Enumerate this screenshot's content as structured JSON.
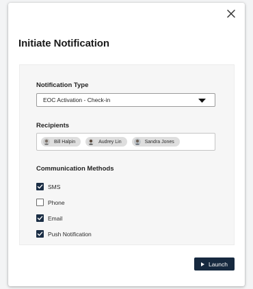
{
  "dialog": {
    "title": "Initiate Notification",
    "close_icon": "close-icon"
  },
  "notification_type": {
    "label": "Notification Type",
    "selected": "EOC Activation - Check-in",
    "icon": "caret-down-icon"
  },
  "recipients": {
    "label": "Recipients",
    "people": [
      {
        "name": "Bill Halpin",
        "icon": "avatar"
      },
      {
        "name": "Audrey Lin",
        "icon": "avatar"
      },
      {
        "name": "Sandra Jones",
        "icon": "avatar"
      }
    ]
  },
  "communication_methods": {
    "label": "Communication Methods",
    "options": [
      {
        "label": "SMS",
        "checked": true
      },
      {
        "label": "Phone",
        "checked": false
      },
      {
        "label": "Email",
        "checked": true
      },
      {
        "label": "Push Notification",
        "checked": true
      }
    ]
  },
  "actions": {
    "launch_label": "Launch",
    "launch_icon": "play-icon"
  },
  "colors": {
    "accent": "#16293f",
    "checkbox_checked": "#1b2e45",
    "panel_background": "#f6f6f6"
  }
}
